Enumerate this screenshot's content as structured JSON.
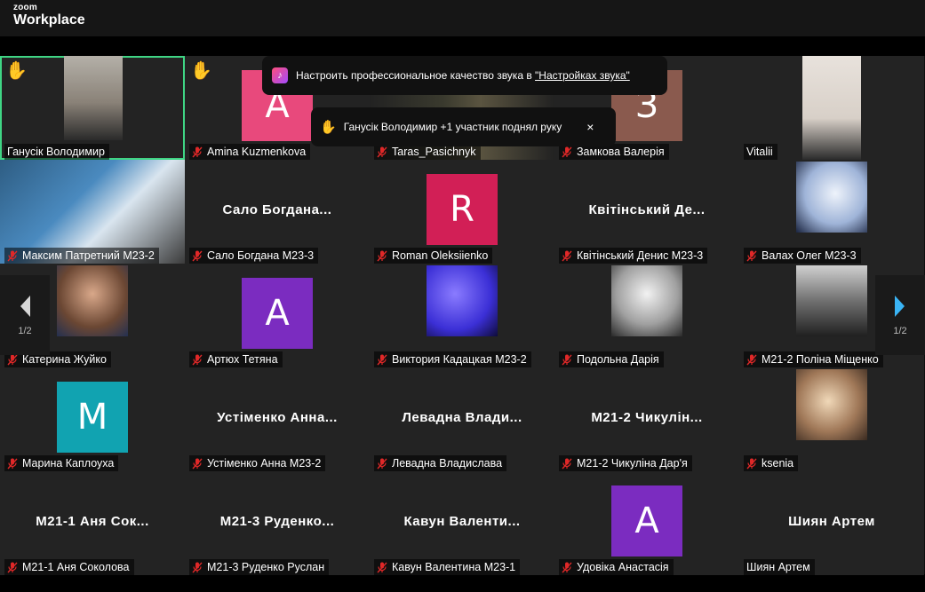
{
  "app": {
    "brand_small": "zoom",
    "brand_big": "Workplace"
  },
  "banners": {
    "audio": {
      "text": "Настроить профессиональное качество звука в ",
      "link": "\"Настройках звука\""
    },
    "hand": {
      "text": "Ганусік Володимир +1 участник поднял руку",
      "close": "×"
    }
  },
  "pager": {
    "prev": "1/2",
    "next": "1/2"
  },
  "participants": [
    {
      "name": "Ганусік Володимир",
      "type": "video",
      "muted": false,
      "hand": true,
      "active": true
    },
    {
      "name": "Amina Kuzmenkova",
      "type": "avatar",
      "letter": "A",
      "color": "#e8497c",
      "muted": true,
      "hand": true
    },
    {
      "name": "Taras_Pasichnyk",
      "type": "video",
      "muted": true
    },
    {
      "name": "Замкова Валерія",
      "type": "avatar",
      "letter": "З",
      "color": "#8a5a4e",
      "muted": true
    },
    {
      "name": "Vitalii",
      "type": "video",
      "muted": false
    },
    {
      "name": "Максим Патретний М23-2",
      "type": "video",
      "muted": true
    },
    {
      "name": "Сало Богдана М23-3",
      "type": "text",
      "short": "Сало Богдана...",
      "muted": true
    },
    {
      "name": "Roman Oleksiienko",
      "type": "avatar",
      "letter": "R",
      "color": "#d21f56",
      "muted": true
    },
    {
      "name": "Квітінський Денис М23-3",
      "type": "text",
      "short": "Квітінський Де...",
      "muted": true
    },
    {
      "name": "Валах Олег М23-3",
      "type": "photo",
      "muted": true
    },
    {
      "name": "Катерина Жуйко",
      "type": "photo",
      "muted": true
    },
    {
      "name": "Артюх Тетяна",
      "type": "avatar",
      "letter": "A",
      "color": "#7b2cc0",
      "muted": true
    },
    {
      "name": "Виктория Кадацкая М23-2",
      "type": "photo",
      "muted": true
    },
    {
      "name": "Подольна Дарія",
      "type": "photo",
      "muted": true
    },
    {
      "name": "М21-2 Поліна Міщенко",
      "type": "photo",
      "muted": true
    },
    {
      "name": "Марина Каплоуха",
      "type": "avatar",
      "letter": "M",
      "color": "#11a3b1",
      "muted": true
    },
    {
      "name": "Устіменко Анна М23-2",
      "type": "text",
      "short": "Устіменко Анна...",
      "muted": true
    },
    {
      "name": "Левадна Владислава",
      "type": "text",
      "short": "Левадна Влади...",
      "muted": true
    },
    {
      "name": "М21-2 Чикуліна Дар'я",
      "type": "text",
      "short": "М21-2 Чикулін...",
      "muted": true
    },
    {
      "name": "ksenia",
      "type": "photo",
      "muted": true
    },
    {
      "name": "М21-1 Аня Соколова",
      "type": "text",
      "short": "М21-1 Аня Сок...",
      "muted": true
    },
    {
      "name": "М21-3 Руденко Руслан",
      "type": "text",
      "short": "М21-3 Руденко...",
      "muted": true
    },
    {
      "name": "Кавун Валентина М23-1",
      "type": "text",
      "short": "Кавун Валенти...",
      "muted": true
    },
    {
      "name": "Удовіка Анастасія",
      "type": "avatar",
      "letter": "A",
      "color": "#7b2cc0",
      "muted": true
    },
    {
      "name": "Шиян Артем",
      "type": "text",
      "short": "Шиян Артем",
      "muted": false
    }
  ]
}
